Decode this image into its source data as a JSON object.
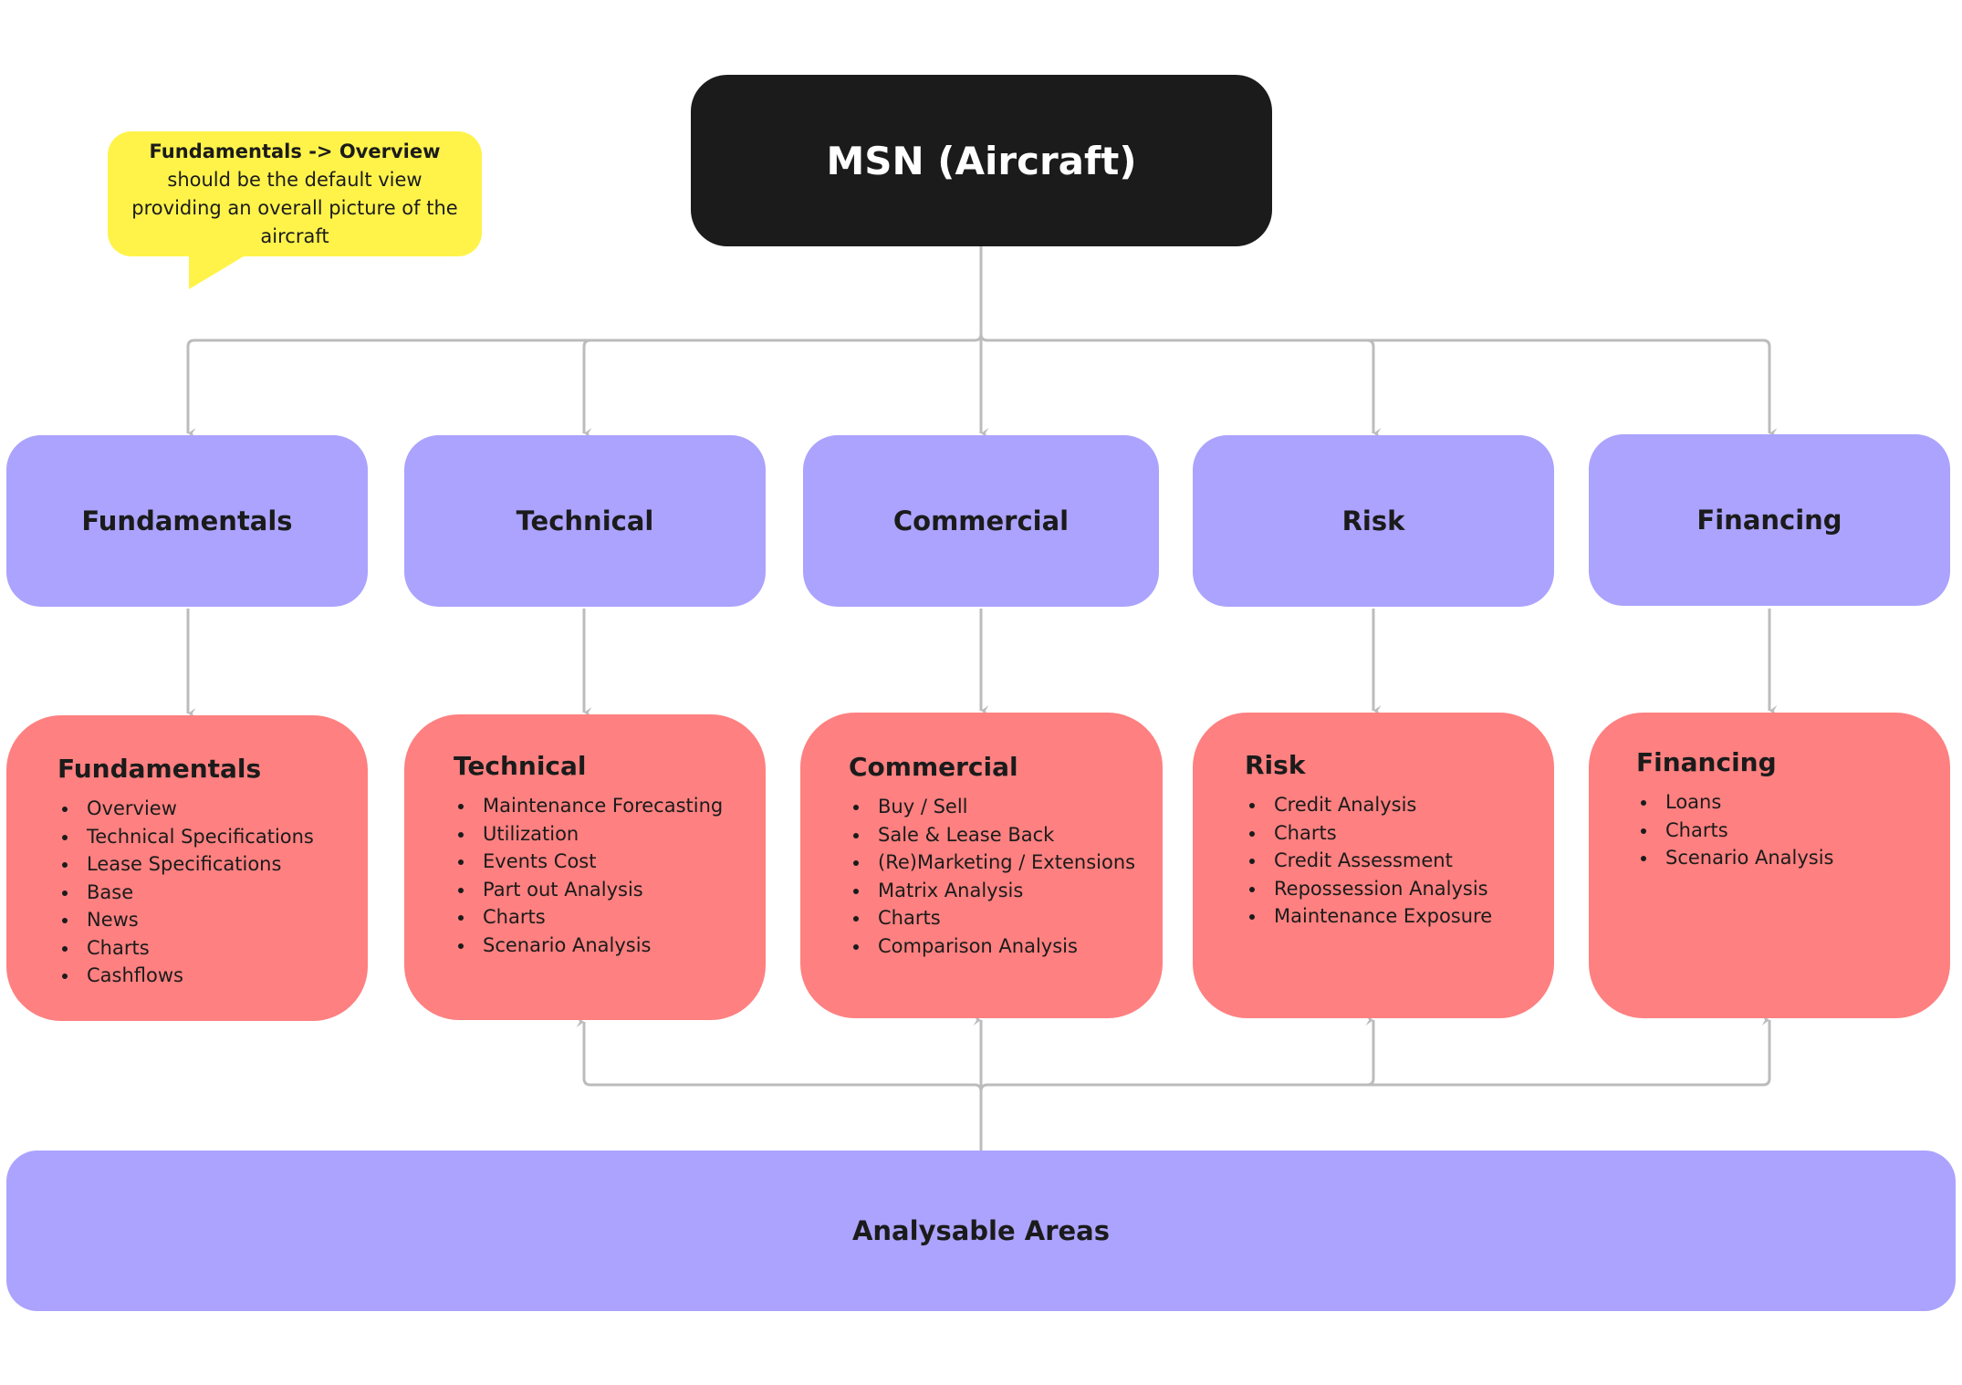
{
  "root": {
    "title": "MSN (Aircraft)"
  },
  "note": {
    "bold_1": "Fundamentals -> Overview",
    "text": " should be the default view providing an overall picture of the aircraft"
  },
  "categories": [
    {
      "label": "Fundamentals"
    },
    {
      "label": "Technical"
    },
    {
      "label": "Commercial"
    },
    {
      "label": "Risk"
    },
    {
      "label": "Financing"
    }
  ],
  "details": [
    {
      "title": "Fundamentals",
      "items": [
        "Overview",
        "Technical Specifications",
        "Lease Specifications",
        "Base",
        "News",
        "Charts",
        "Cashflows"
      ]
    },
    {
      "title": "Technical",
      "items": [
        "Maintenance Forecasting",
        "Utilization",
        "Events Cost",
        "Part out Analysis",
        "Charts",
        "Scenario Analysis"
      ]
    },
    {
      "title": "Commercial",
      "items": [
        "Buy / Sell",
        "Sale & Lease Back",
        "(Re)Marketing / Extensions",
        "Matrix Analysis",
        "Charts",
        "Comparison Analysis"
      ]
    },
    {
      "title": "Risk",
      "items": [
        "Credit Analysis",
        "Charts",
        "Credit Assessment",
        "Repossession Analysis",
        "Maintenance Exposure"
      ]
    },
    {
      "title": "Financing",
      "items": [
        "Loans",
        "Charts",
        "Scenario Analysis"
      ]
    }
  ],
  "bottom": {
    "label": "Analysable Areas"
  },
  "colors": {
    "root": "#1b1b1b",
    "category": "#aba3fd",
    "detail": "#fe8080",
    "note": "#fff34a",
    "connector": "#bcbcbc"
  }
}
